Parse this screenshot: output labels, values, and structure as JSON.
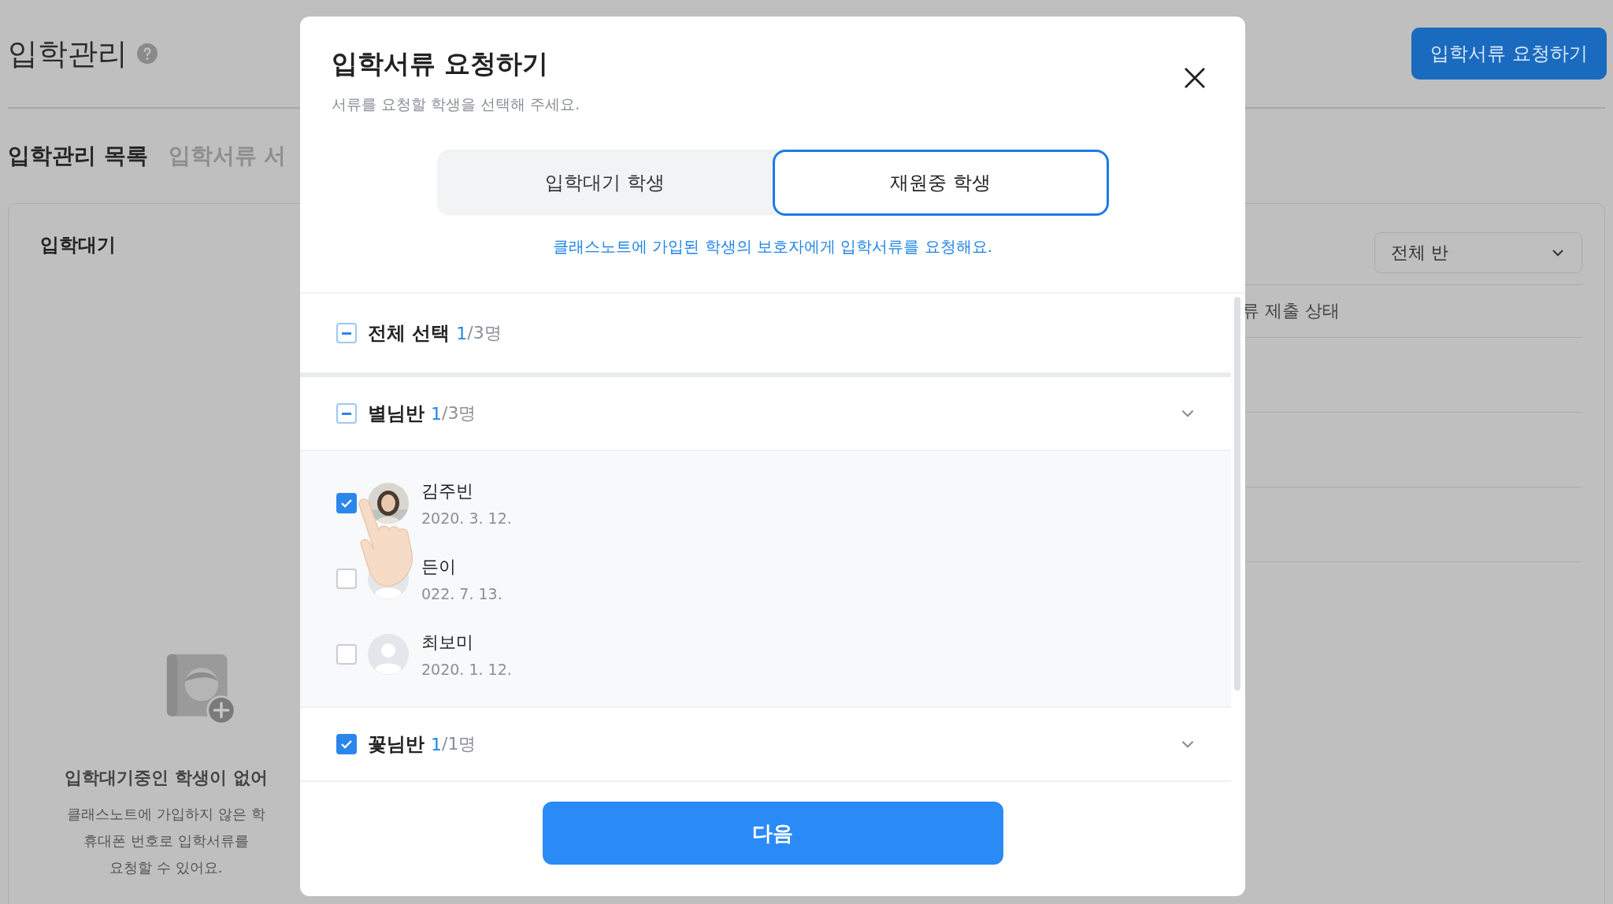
{
  "page": {
    "title": "입학관리",
    "tabs": [
      {
        "label": "입학관리 목록",
        "selected": true
      },
      {
        "label": "입학서류 서",
        "selected": false
      }
    ],
    "request_button": "입학서류 요청하기",
    "panel": {
      "title": "입학대기",
      "class_filter": "전체 반",
      "table_header": "류 제출 상태",
      "empty_title": "입학대기중인 학생이 없어",
      "empty_lines": [
        "클래스노트에 가입하지 않은 학",
        "휴대폰 번호로 입학서류를",
        "요청할 수 있어요."
      ]
    }
  },
  "dialog": {
    "title": "입학서류 요청하기",
    "subtitle": "서류를 요청할 학생을 선택해 주세요.",
    "tabs": [
      {
        "label": "입학대기 학생",
        "selected": false
      },
      {
        "label": "재원중 학생",
        "selected": true
      }
    ],
    "info": "클래스노트에 가입된 학생의 보호자에게 입학서류를 요청해요.",
    "select_all": {
      "label": "전체 선택",
      "count": "1",
      "total": "/3명",
      "checked": false,
      "partial": true
    },
    "groups": [
      {
        "name": "별님반",
        "count": "1",
        "total": "/3명",
        "checked": false,
        "partial": true,
        "students": [
          {
            "name": "김주빈",
            "birth": "2020. 3. 12.",
            "checked": true
          },
          {
            "name": "든이",
            "birth": "022. 7. 13.",
            "checked": false,
            "kind": "default"
          },
          {
            "name": "최보미",
            "birth": "2020. 1. 12.",
            "checked": false,
            "kind": "default"
          }
        ]
      },
      {
        "name": "꽃님반",
        "count": "1",
        "total": "/1명",
        "checked": true,
        "partial": false
      }
    ],
    "next_button": "다음"
  }
}
